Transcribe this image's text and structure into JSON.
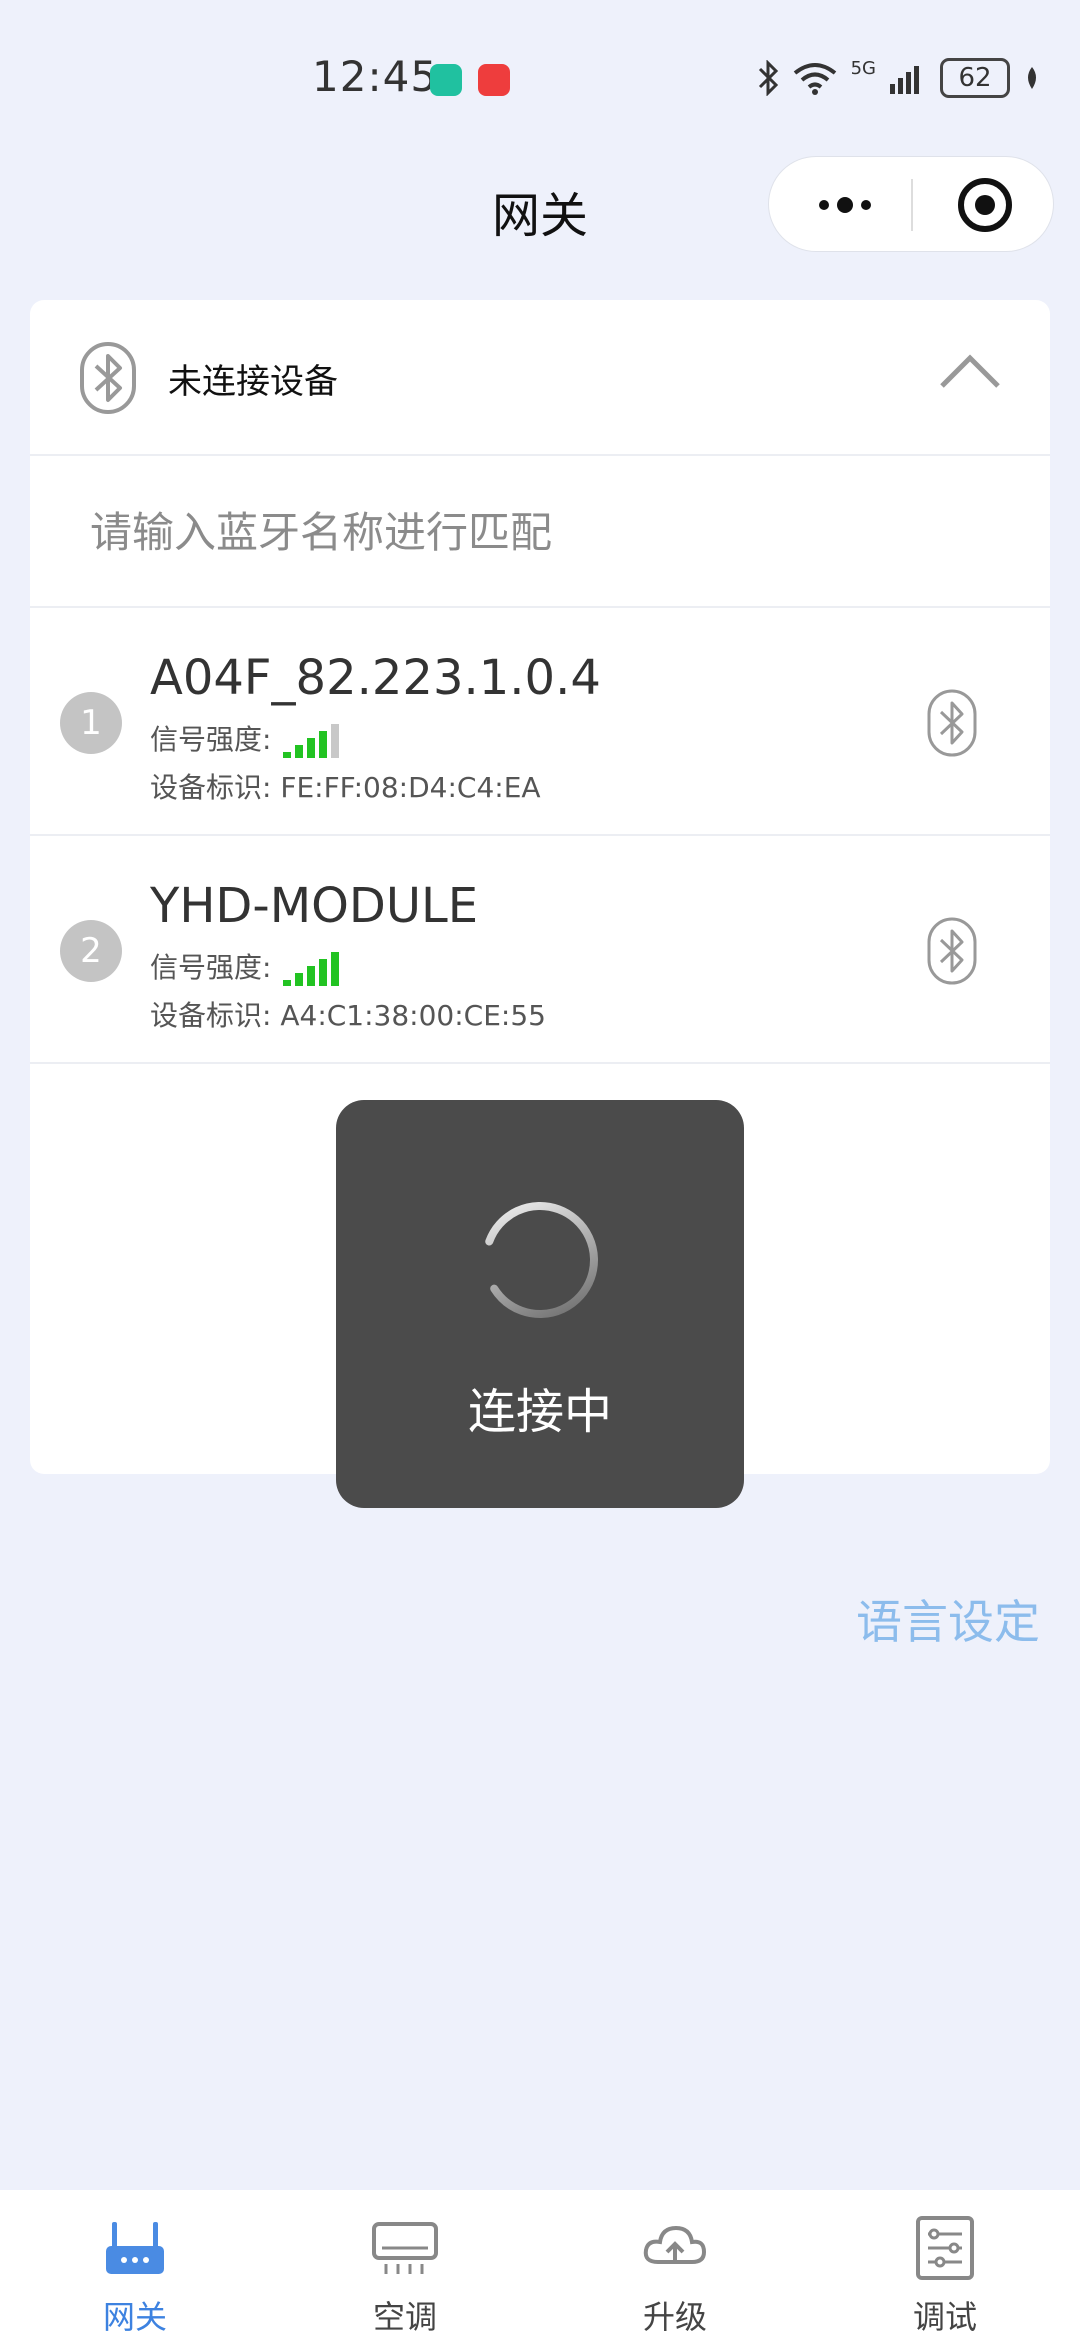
{
  "status_bar": {
    "time": "12:45",
    "network": "5G",
    "battery": "62"
  },
  "header": {
    "title": "网关"
  },
  "device_panel": {
    "status_label": "未连接设备",
    "search_placeholder": "请输入蓝牙名称进行匹配",
    "devices": [
      {
        "index": "1",
        "name": "A04F_82.223.1.0.4",
        "signal_label": "信号强度:",
        "signal_level": 4,
        "signal_max": 5,
        "mac_label": "设备标识:",
        "mac": "FE:FF:08:D4:C4:EA"
      },
      {
        "index": "2",
        "name": "YHD-MODULE",
        "signal_label": "信号强度:",
        "signal_level": 5,
        "signal_max": 5,
        "mac_label": "设备标识:",
        "mac": "A4:C1:38:00:CE:55"
      }
    ]
  },
  "toast": {
    "text": "连接中"
  },
  "language_link": "语言设定",
  "tabbar": {
    "tabs": [
      {
        "label": "网关",
        "icon": "router-icon",
        "active": true
      },
      {
        "label": "空调",
        "icon": "air-conditioner-icon",
        "active": false
      },
      {
        "label": "升级",
        "icon": "cloud-upload-icon",
        "active": false
      },
      {
        "label": "调试",
        "icon": "debug-settings-icon",
        "active": false
      }
    ]
  },
  "colors": {
    "background": "#eef1fb",
    "accent": "#3d82e0",
    "link": "#8cbcec",
    "signal_on": "#22c322",
    "signal_off": "#c8c8c8",
    "toast_bg": "#4b4b4b"
  }
}
